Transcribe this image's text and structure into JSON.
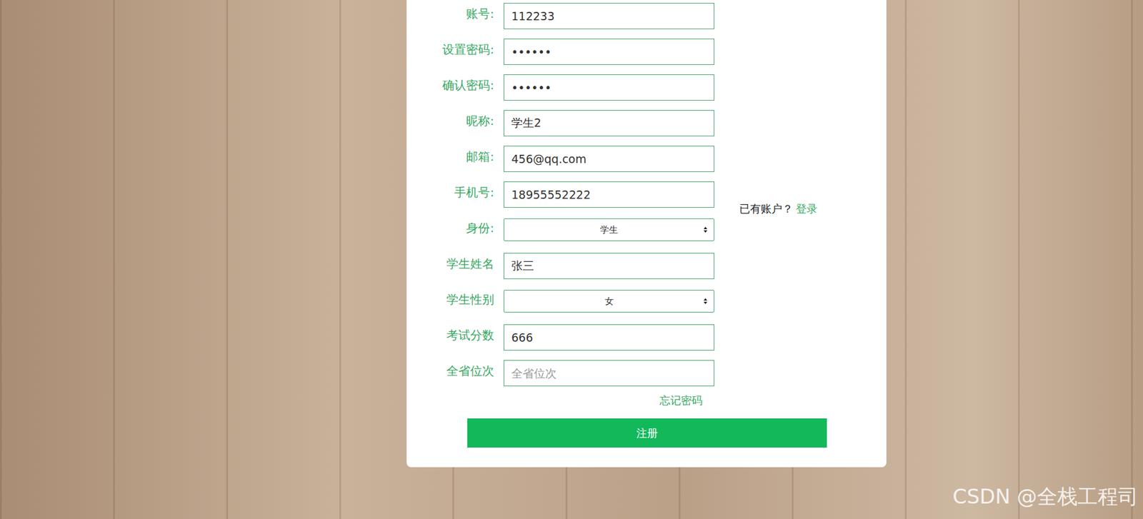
{
  "fields": [
    {
      "label": "账号:",
      "kind": "input",
      "value": "112233",
      "placeholder": ""
    },
    {
      "label": "设置密码:",
      "kind": "input",
      "value": "••••••",
      "placeholder": ""
    },
    {
      "label": "确认密码:",
      "kind": "input",
      "value": "••••••",
      "placeholder": ""
    },
    {
      "label": "昵称:",
      "kind": "input",
      "value": "学生2",
      "placeholder": ""
    },
    {
      "label": "邮箱:",
      "kind": "input",
      "value": "456@qq.com",
      "placeholder": ""
    },
    {
      "label": "手机号:",
      "kind": "input",
      "value": "18955552222",
      "placeholder": ""
    },
    {
      "label": "身份:",
      "kind": "select",
      "value": "学生",
      "placeholder": ""
    },
    {
      "label": "学生姓名",
      "kind": "input",
      "value": "张三",
      "placeholder": ""
    },
    {
      "label": "学生性别",
      "kind": "select",
      "value": "女",
      "placeholder": ""
    },
    {
      "label": "考试分数",
      "kind": "input",
      "value": "666",
      "placeholder": ""
    },
    {
      "label": "全省位次",
      "kind": "input",
      "value": "",
      "placeholder": "全省位次"
    }
  ],
  "forgot_password": "忘记密码",
  "login_prompt": "已有账户？",
  "login_link": "登录",
  "submit_button": "注册",
  "watermark": "CSDN @全栈工程司"
}
